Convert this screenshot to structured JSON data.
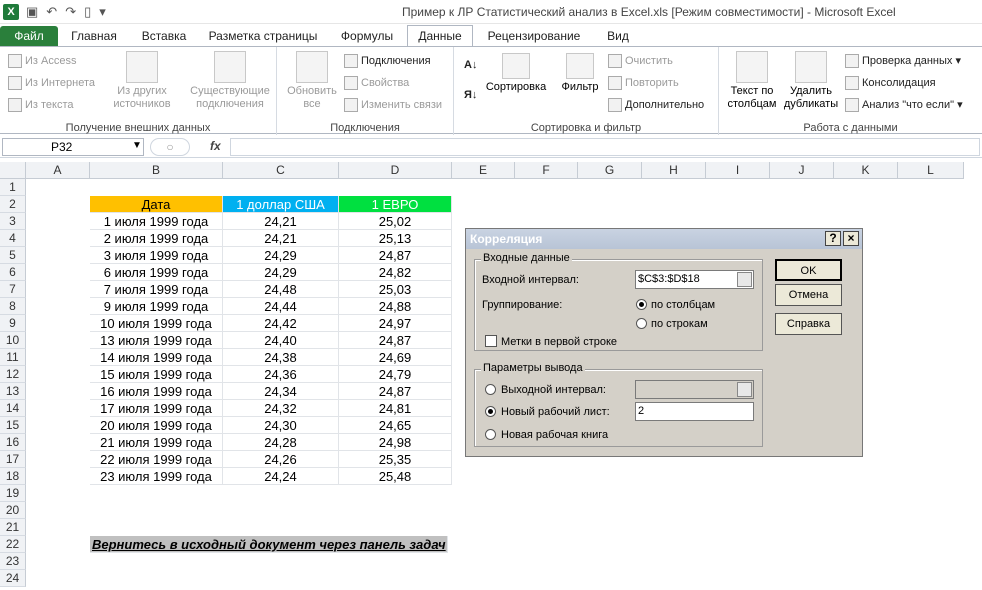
{
  "window": {
    "title": "Пример к ЛР Статистический анализ в Excel.xls  [Режим совместимости]  -  Microsoft Excel"
  },
  "tabs": [
    "Файл",
    "Главная",
    "Вставка",
    "Разметка страницы",
    "Формулы",
    "Данные",
    "Рецензирование",
    "Вид"
  ],
  "ribbon": {
    "g1": {
      "label": "Получение внешних данных",
      "access": "Из Access",
      "web": "Из Интернета",
      "text": "Из текста",
      "other": "Из других\nисточников",
      "existing": "Существующие\nподключения"
    },
    "g2": {
      "label": "Подключения",
      "refresh": "Обновить\nвсе",
      "connections": "Подключения",
      "props": "Свойства",
      "links": "Изменить связи"
    },
    "g3": {
      "label": "Сортировка и фильтр",
      "sort": "Сортировка",
      "filter": "Фильтр",
      "clear": "Очистить",
      "reapply": "Повторить",
      "advanced": "Дополнительно"
    },
    "g4": {
      "label": "Работа с данными",
      "t2c": "Текст по\nстолбцам",
      "dup": "Удалить\nдубликаты",
      "validate": "Проверка данных",
      "consolidate": "Консолидация",
      "whatif": "Анализ \"что если\""
    }
  },
  "namebox": "P32",
  "fx": "fx",
  "columns": [
    "A",
    "B",
    "C",
    "D",
    "E",
    "F",
    "G",
    "H",
    "I",
    "J",
    "K",
    "L"
  ],
  "rows": [
    "1",
    "2",
    "3",
    "4",
    "5",
    "6",
    "7",
    "8",
    "9",
    "10",
    "11",
    "12",
    "13",
    "14",
    "15",
    "16",
    "17",
    "18",
    "19",
    "20",
    "21",
    "22",
    "23",
    "24"
  ],
  "headers": {
    "date": "Дата",
    "usd": "1 доллар США",
    "eur": "1 ЕВРО"
  },
  "table": [
    [
      "1 июля 1999 года",
      "24,21",
      "25,02"
    ],
    [
      "2 июля 1999 года",
      "24,21",
      "25,13"
    ],
    [
      "3 июля 1999 года",
      "24,29",
      "24,87"
    ],
    [
      "6 июля 1999 года",
      "24,29",
      "24,82"
    ],
    [
      "7 июля 1999 года",
      "24,48",
      "25,03"
    ],
    [
      "9 июля 1999 года",
      "24,44",
      "24,88"
    ],
    [
      "10 июля 1999 года",
      "24,42",
      "24,97"
    ],
    [
      "13 июля 1999 года",
      "24,40",
      "24,87"
    ],
    [
      "14 июля 1999 года",
      "24,38",
      "24,69"
    ],
    [
      "15 июля 1999 года",
      "24,36",
      "24,79"
    ],
    [
      "16 июля 1999 года",
      "24,34",
      "24,87"
    ],
    [
      "17 июля 1999 года",
      "24,32",
      "24,81"
    ],
    [
      "20 июля 1999 года",
      "24,30",
      "24,65"
    ],
    [
      "21 июля 1999 года",
      "24,28",
      "24,98"
    ],
    [
      "22 июля 1999 года",
      "24,26",
      "25,35"
    ],
    [
      "23 июля 1999 года",
      "24,24",
      "25,48"
    ]
  ],
  "note": "Вернитесь в исходный документ через панель задач",
  "colors": {
    "date": "#ffc000",
    "usd": "#00b0f0",
    "eur": "#00e040",
    "note": "#c0c0c0",
    "file_tab": "#2a7f3b"
  },
  "dialog": {
    "title": "Корреляция",
    "help": "?",
    "close": "×",
    "input_group": "Входные данные",
    "input_range_label": "Входной интервал:",
    "input_range": "$C$3:$D$18",
    "grouping_label": "Группирование:",
    "by_cols": "по столбцам",
    "by_rows": "по строкам",
    "labels_first": "Метки в первой строке",
    "output_group": "Параметры вывода",
    "out_range": "Выходной интервал:",
    "new_sheet": "Новый рабочий лист:",
    "new_sheet_value": "2",
    "new_book": "Новая рабочая книга",
    "ok": "OK",
    "cancel": "Отмена",
    "help_btn": "Справка"
  }
}
